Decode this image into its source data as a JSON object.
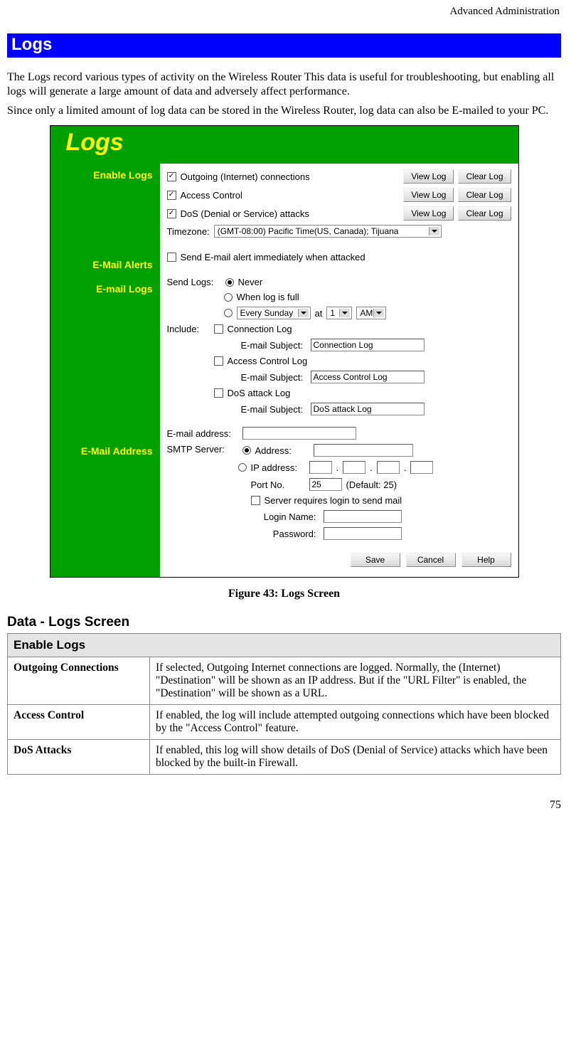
{
  "header": {
    "breadcrumb": "Advanced Administration"
  },
  "section": {
    "title": "Logs"
  },
  "intro": {
    "p1": "The Logs record various types of activity on the Wireless Router This data is useful for troubleshooting, but enabling all logs will generate a large amount of data and adversely affect performance.",
    "p2": "Since only a limited amount of log data can be stored in the Wireless Router, log data can also be E-mailed to your PC."
  },
  "figure": {
    "logo": "Logs",
    "side": {
      "enable": "Enable Logs",
      "alerts": "E-Mail Alerts",
      "logs": "E-mail Logs",
      "address": "E-Mail Address"
    },
    "enable": {
      "outgoing": "Outgoing (Internet) connections",
      "access": "Access Control",
      "dos": "DoS (Denial or Service) attacks",
      "view": "View Log",
      "clear": "Clear Log",
      "tz_label": "Timezone:",
      "tz_value": "(GMT-08:00) Pacific Time(US, Canada); Tijuana"
    },
    "alerts": {
      "send": "Send E-mail alert immediately when attacked"
    },
    "email_logs": {
      "send_label": "Send Logs:",
      "never": "Never",
      "full": "When log is full",
      "every_value": "Every Sunday",
      "at": "at",
      "hour": "1",
      "ampm": "AM",
      "include_label": "Include:",
      "conn": "Connection Log",
      "subj_label": "E-mail Subject:",
      "conn_subj": "Connection Log",
      "ac": "Access Control Log",
      "ac_subj": "Access Control Log",
      "dos": "DoS attack Log",
      "dos_subj": "DoS attack Log"
    },
    "email_addr": {
      "addr_label": "E-mail address:",
      "smtp_label": "SMTP Server:",
      "addr_opt": "Address:",
      "ip_opt": "IP address:",
      "port_label": "Port No.",
      "port_value": "25",
      "port_default": "(Default: 25)",
      "requires": "Server requires login to send mail",
      "login_label": "Login Name:",
      "pass_label": "Password:"
    },
    "buttons": {
      "save": "Save",
      "cancel": "Cancel",
      "help": "Help"
    },
    "caption": "Figure 43: Logs Screen"
  },
  "data_section": {
    "heading": "Data - Logs Screen",
    "section_header": "Enable Logs",
    "rows": [
      {
        "label": "Outgoing Connections",
        "desc": "If selected, Outgoing Internet connections are logged. Normally, the (Internet) \"Destination\" will be shown as an IP address. But if the \"URL Filter\" is enabled, the \"Destination\" will be shown as a URL."
      },
      {
        "label": "Access Control",
        "desc": "If enabled, the log will include attempted outgoing connections which have been blocked by the \"Access Control\" feature."
      },
      {
        "label": "DoS Attacks",
        "desc": "If enabled, this log will show details of DoS (Denial of Service) attacks which have been blocked by the built-in Firewall."
      }
    ]
  },
  "page_number": "75"
}
